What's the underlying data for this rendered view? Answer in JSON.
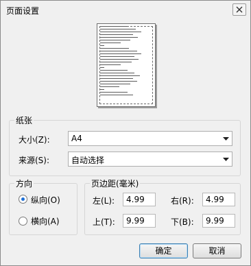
{
  "window": {
    "title": "页面设置"
  },
  "paper": {
    "group_label": "纸张",
    "size_label": "大小(Z):",
    "size_value": "A4",
    "source_label": "来源(S):",
    "source_value": "自动选择"
  },
  "orientation": {
    "group_label": "方向",
    "portrait_label": "纵向(O)",
    "landscape_label": "横向(A)",
    "selected": "portrait"
  },
  "margins": {
    "group_label": "页边距(毫米)",
    "left_label": "左(L):",
    "left_value": "4.99",
    "right_label": "右(R):",
    "right_value": "4.99",
    "top_label": "上(T):",
    "top_value": "9.99",
    "bottom_label": "下(B):",
    "bottom_value": "9.99"
  },
  "buttons": {
    "ok": "确定",
    "cancel": "取消"
  },
  "icons": {
    "close": "close-icon",
    "dropdown": "chevron-down-icon"
  }
}
